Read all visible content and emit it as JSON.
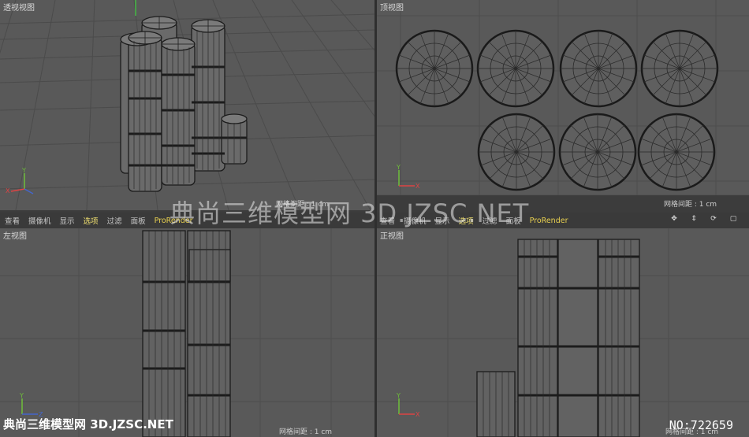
{
  "viewports": {
    "perspective": {
      "title": "透视视图",
      "grid_label": "网格间距 : 1 cm"
    },
    "top": {
      "title": "顶视图",
      "grid_label": "网格间距 : 1 cm"
    },
    "left": {
      "title": "左视图",
      "grid_label": "网格间距 : 1 cm"
    },
    "front": {
      "title": "正视图",
      "grid_label": "网格间距 : 1 cm"
    }
  },
  "menubar_left": [
    "查看",
    "摄像机",
    "显示",
    "选项",
    "过滤",
    "面板",
    "ProRender"
  ],
  "menubar_right": [
    "查看",
    "摄像机",
    "显示",
    "选项",
    "过滤",
    "面板",
    "ProRender"
  ],
  "axes": {
    "x": "X",
    "y": "Y",
    "z": "Z"
  },
  "watermark": {
    "center": "典尚三维模型网 3D.JZSC.NET",
    "bottom_left": "典尚三维模型网 3D.JZSC.NET",
    "bottom_right": "NO:722659"
  },
  "colors": {
    "viewport_bg": "#595959",
    "menubar_bg": "#3a3a3a",
    "highlight": "#f0e070",
    "wire": "#1c1c1c"
  }
}
